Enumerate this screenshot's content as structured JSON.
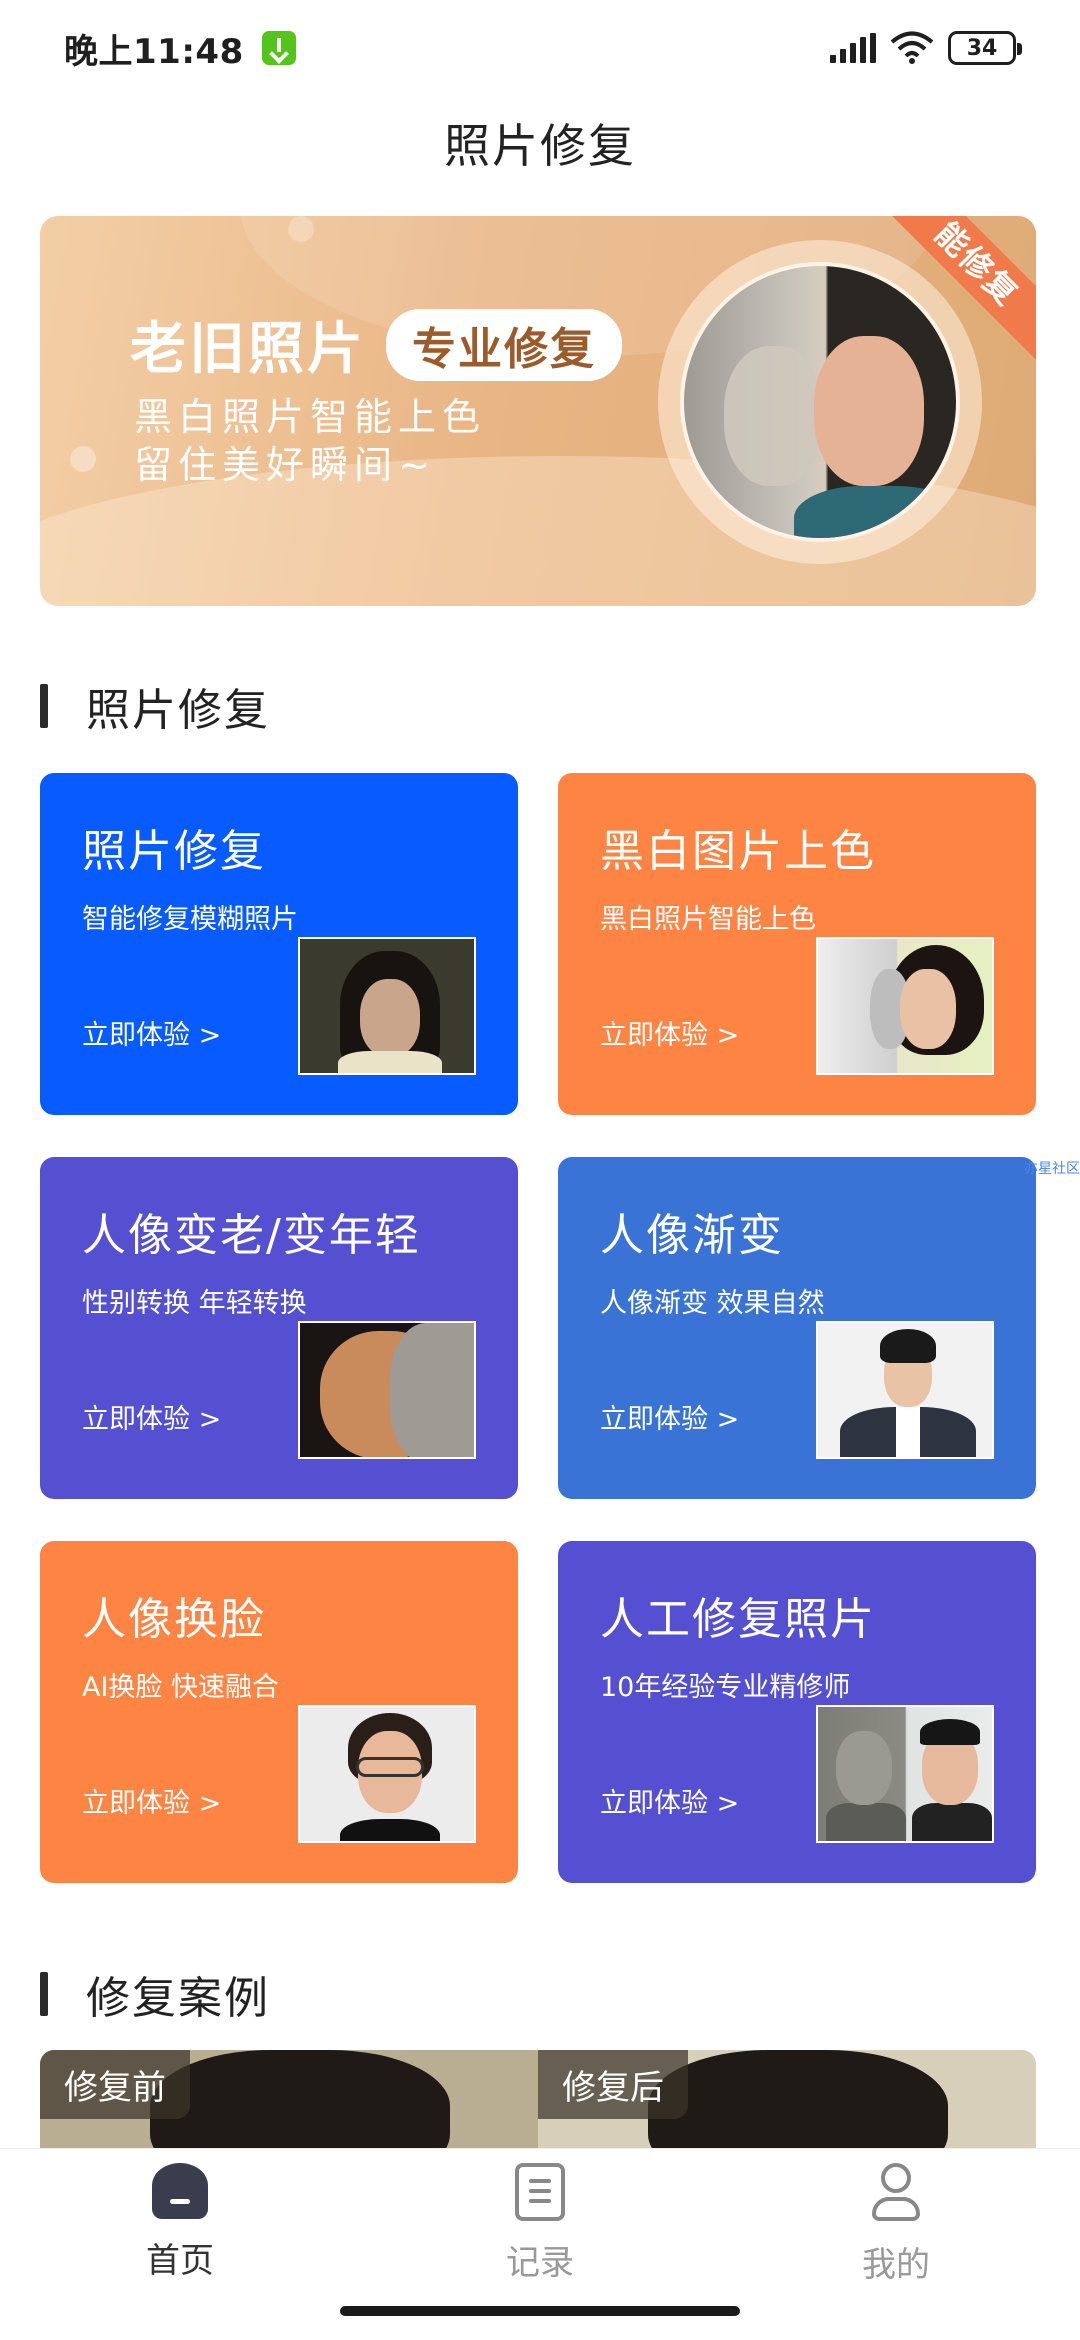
{
  "status_bar": {
    "time": "晚上11:48",
    "battery": "34"
  },
  "header": {
    "title": "照片修复"
  },
  "banner": {
    "title": "老旧照片",
    "pill": "专业修复",
    "line1": "黑白照片智能上色",
    "line2": "留住美好瞬间~",
    "ribbon": "能修复"
  },
  "section_repair": {
    "title": "照片修复"
  },
  "cards": [
    {
      "title": "照片修复",
      "desc": "智能修复模糊照片",
      "cta": "立即体验 >"
    },
    {
      "title": "黑白图片上色",
      "desc": "黑白照片智能上色",
      "cta": "立即体验 >"
    },
    {
      "title": "人像变老/变年轻",
      "desc": "性别转换 年轻转换",
      "cta": "立即体验 >"
    },
    {
      "title": "人像渐变",
      "desc": "人像渐变 效果自然",
      "cta": "立即体验 >"
    },
    {
      "title": "人像换脸",
      "desc": "AI换脸 快速融合",
      "cta": "立即体验 >"
    },
    {
      "title": "人工修复照片",
      "desc": "10年经验专业精修师",
      "cta": "立即体验 >"
    }
  ],
  "watermark": "亦星社区",
  "section_cases": {
    "title": "修复案例"
  },
  "cases": {
    "before": "修复前",
    "after": "修复后"
  },
  "bottom_nav": [
    {
      "label": "首页",
      "icon": "home-icon",
      "active": true
    },
    {
      "label": "记录",
      "icon": "record-icon",
      "active": false
    },
    {
      "label": "我的",
      "icon": "profile-icon",
      "active": false
    }
  ],
  "colors": {
    "blue": "#075bff",
    "orange": "#fe8444",
    "purple": "#5550d2",
    "mid_blue": "#3a73d6"
  }
}
